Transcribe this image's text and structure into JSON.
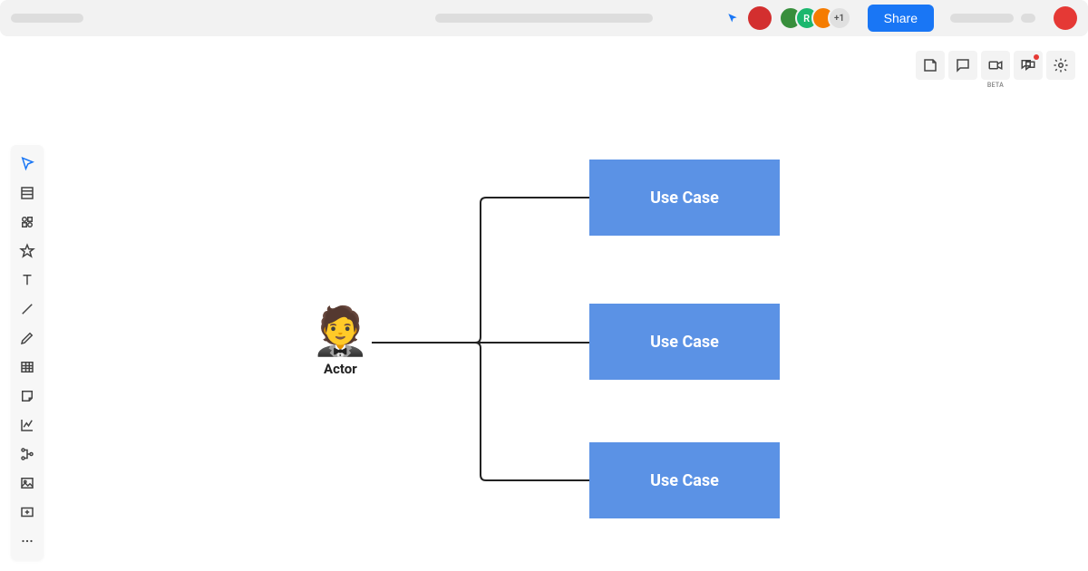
{
  "topbar": {
    "share_label": "Share",
    "overflow_count": "+1"
  },
  "right_toolbar": {
    "beta_label": "BETA"
  },
  "diagram": {
    "actor": {
      "emoji": "🤵",
      "label": "Actor"
    },
    "usecases": [
      {
        "label": "Use Case"
      },
      {
        "label": "Use Case"
      },
      {
        "label": "Use Case"
      }
    ]
  },
  "colors": {
    "primary": "#1976f5",
    "usecase_fill": "#5b92e5"
  }
}
